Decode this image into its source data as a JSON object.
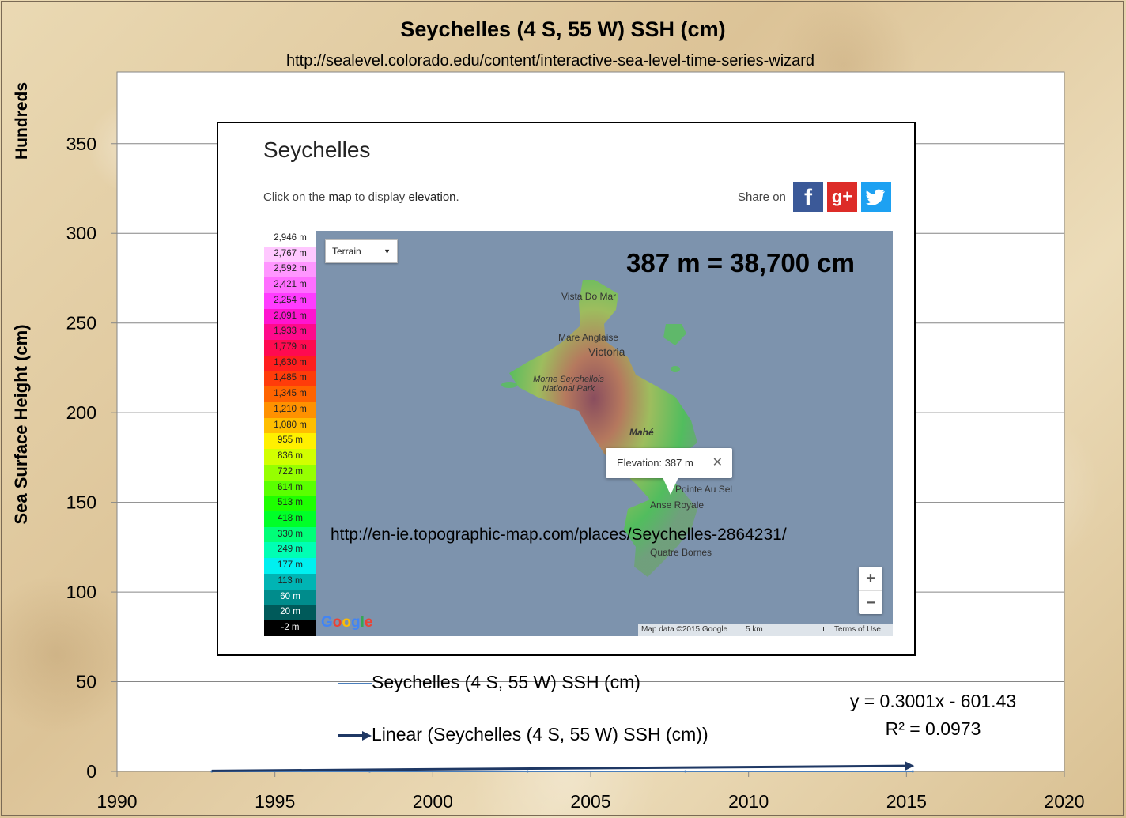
{
  "chart_data": {
    "type": "line",
    "title": "Seychelles (4 S, 55 W) SSH (cm)",
    "subtitle": "http://sealevel.colorado.edu/content/interactive-sea-level-time-series-wizard",
    "ylabel": "Sea Surface Height (cm)",
    "yunits": "Hundreds",
    "xlim": [
      1990,
      2020
    ],
    "ylim": [
      0,
      390
    ],
    "xticks": [
      1990,
      1995,
      2000,
      2005,
      2010,
      2015,
      2020
    ],
    "yticks": [
      0,
      50,
      100,
      150,
      200,
      250,
      300,
      350
    ],
    "grid": true,
    "series": [
      {
        "name": "Seychelles (4 S, 55 W) SSH (cm)",
        "color": "#4a7ebb",
        "x": [
          1993,
          1998,
          2003,
          2008,
          2015.2
        ],
        "y": [
          0,
          0,
          0,
          0,
          0
        ]
      },
      {
        "name": "Linear (Seychelles (4 S, 55 W) SSH (cm))",
        "color": "#1f3864",
        "x": [
          1993,
          2015.2
        ],
        "y": [
          0.28,
          3.01
        ]
      }
    ],
    "trendline": {
      "equation": "y = 0.3001x - 601.43",
      "r2": "R² = 0.0973"
    },
    "legend_position": "bottom-center"
  },
  "inset": {
    "title": "Seychelles",
    "instruction_parts": [
      "Click on the ",
      "map",
      " to display ",
      "elevation",
      "."
    ],
    "share_label": "Share on",
    "share_icons": [
      "facebook-icon",
      "google-plus-icon",
      "twitter-icon"
    ],
    "map_type": "Terrain",
    "annotation": "387 m = 38,700 cm",
    "popup": "Elevation: 387 m",
    "source_url": "http://en-ie.topographic-map.com/places/Seychelles-2864231/",
    "attribution": "Map data ©2015 Google",
    "scale_label": "5 km",
    "terms": "Terms of Use",
    "google_logo": "Google",
    "places": [
      "Vista Do Mar",
      "Mare Anglaise",
      "Victoria",
      "Morne Seychellois National Park",
      "Mahé",
      "Pointe Au Sel",
      "Anse Royale",
      "Quatre Bornes"
    ],
    "elevation_scale": [
      {
        "label": "2,946 m",
        "color": "#ffffff"
      },
      {
        "label": "2,767 m",
        "color": "#ffc8ff"
      },
      {
        "label": "2,592 m",
        "color": "#ff96ff"
      },
      {
        "label": "2,421 m",
        "color": "#ff6eff"
      },
      {
        "label": "2,254 m",
        "color": "#ff3cff"
      },
      {
        "label": "2,091 m",
        "color": "#ff14d0"
      },
      {
        "label": "1,933 m",
        "color": "#ff0a8c"
      },
      {
        "label": "1,779 m",
        "color": "#ff0a50"
      },
      {
        "label": "1,630 m",
        "color": "#ff1e1e"
      },
      {
        "label": "1,485 m",
        "color": "#ff3c0a"
      },
      {
        "label": "1,345 m",
        "color": "#ff6400"
      },
      {
        "label": "1,210 m",
        "color": "#ff9100"
      },
      {
        "label": "1,080 m",
        "color": "#ffbe00"
      },
      {
        "label": "955 m",
        "color": "#fff000"
      },
      {
        "label": "836 m",
        "color": "#d2ff00"
      },
      {
        "label": "722 m",
        "color": "#96ff00"
      },
      {
        "label": "614 m",
        "color": "#5aff00"
      },
      {
        "label": "513 m",
        "color": "#1eff00"
      },
      {
        "label": "418 m",
        "color": "#00ff28"
      },
      {
        "label": "330 m",
        "color": "#00ff78"
      },
      {
        "label": "249 m",
        "color": "#00ffb4"
      },
      {
        "label": "177 m",
        "color": "#00f0f0"
      },
      {
        "label": "113 m",
        "color": "#00b4b4"
      },
      {
        "label": "60 m",
        "color": "#008c8c"
      },
      {
        "label": "20 m",
        "color": "#005a5a"
      },
      {
        "label": "-2 m",
        "color": "#000000"
      }
    ]
  }
}
